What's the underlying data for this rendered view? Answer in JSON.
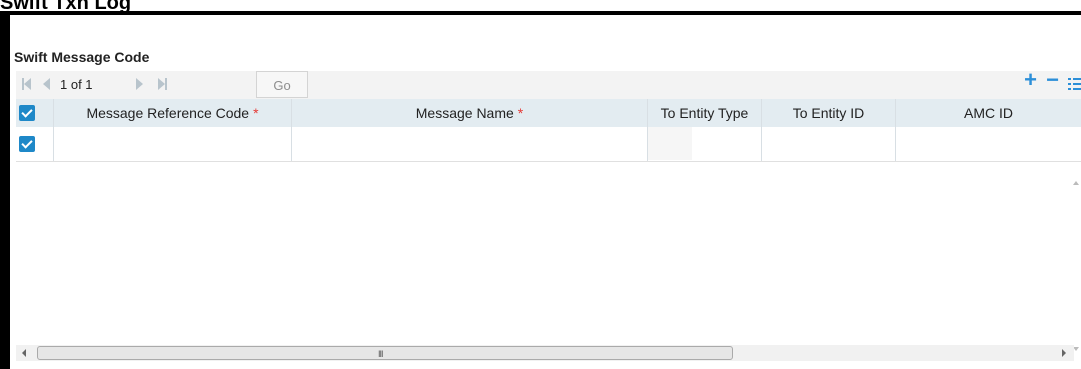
{
  "page": {
    "heading": "Swift Txn Log"
  },
  "section": {
    "title": "Swift Message Code"
  },
  "toolbar": {
    "page_info": "1 of 1",
    "go_label": "Go",
    "add_symbol": "+",
    "remove_symbol": "−"
  },
  "grid": {
    "columns": [
      {
        "label": "Message Reference Code",
        "required_marker": "*"
      },
      {
        "label": "Message Name",
        "required_marker": "*"
      },
      {
        "label": "To Entity Type"
      },
      {
        "label": "To Entity ID"
      },
      {
        "label": "AMC ID"
      }
    ],
    "rows": [
      {
        "checked": true,
        "message_reference_code": "",
        "message_name": "",
        "to_entity_type": "",
        "to_entity_id": "",
        "amc_id": ""
      }
    ]
  },
  "scrollbar": {
    "grip": "III"
  },
  "icons": {
    "first_page": "first-page-icon",
    "prev_page": "prev-page-icon",
    "next_page": "next-page-icon",
    "last_page": "last-page-icon",
    "add": "plus-icon",
    "remove": "minus-icon",
    "columns": "list-icon",
    "checkbox": "checkbox-icon"
  },
  "colors": {
    "accent": "#2c8fd8",
    "checkbox": "#1e88c8",
    "header_bg": "#e3ecf1",
    "required": "#e53935",
    "disabled_nav": "#b8c4cc"
  }
}
